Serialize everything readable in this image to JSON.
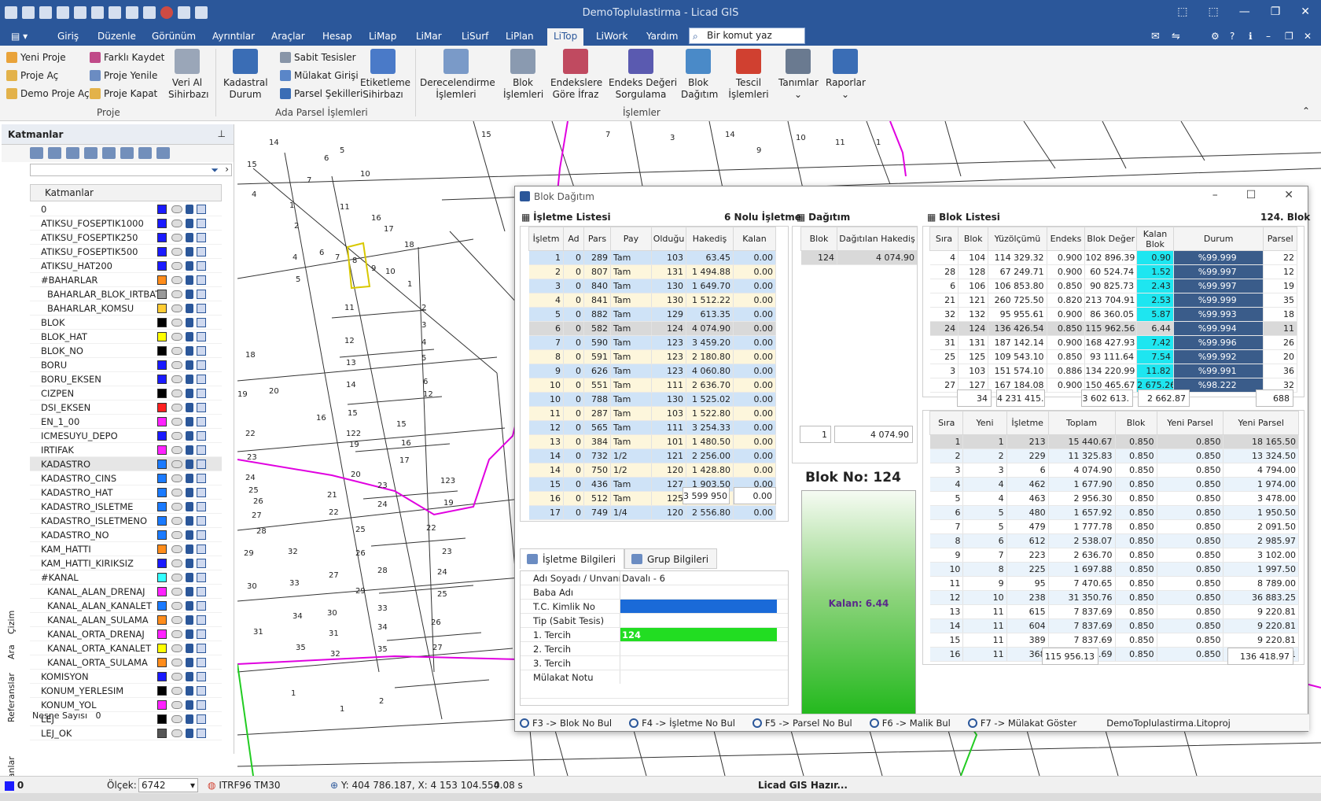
{
  "window": {
    "title": "DemoToplulastirma - Licad GIS",
    "controls": [
      "⬚",
      "⬚",
      "—",
      "❐",
      "✕"
    ]
  },
  "tabs": [
    "Giriş",
    "Düzenle",
    "Görünüm",
    "Ayrıntılar",
    "Araçlar",
    "Hesap",
    "LiMap",
    "LiMar",
    "LiSurf",
    "LiPlan",
    "LiTop",
    "LiWork",
    "Yardım"
  ],
  "active_tab": "LiTop",
  "command_search": {
    "placeholder": "Bir komut yaz"
  },
  "ribbon": {
    "proje": {
      "items": [
        "Yeni Proje",
        "Proje Aç",
        "Demo Proje Aç",
        "Farklı Kaydet",
        "Proje Yenile",
        "Proje Kapat"
      ],
      "big": "Veri Al\nSihirbazı",
      "group": "Proje"
    },
    "ada": {
      "kadastral": "Kadastral\nDurum",
      "items": [
        "Sabit Tesisler",
        "Mülakat Girişi",
        "Parsel Şekilleri"
      ],
      "etiket": "Etiketleme\nSihirbazı",
      "group": "Ada Parsel İşlemleri"
    },
    "big": [
      "Derecelendirme\nİşlemleri",
      "Blok\nİşlemleri",
      "Endekslere\nGöre İfraz",
      "Endeks Değeri\nSorgulama",
      "Blok\nDağıtım",
      "Tescil\nİşlemleri",
      "Tanımlar",
      "Raporlar"
    ],
    "islemler_group": "İşlemler"
  },
  "layers_panel": {
    "title": "Katmanlar",
    "column": "Katmanlar",
    "rows": [
      {
        "name": "0",
        "color": "#1a1aff"
      },
      {
        "name": "ATIKSU_FOSEPTIK1000",
        "color": "#1a1aff"
      },
      {
        "name": "ATIKSU_FOSEPTIK250",
        "color": "#1a1aff"
      },
      {
        "name": "ATIKSU_FOSEPTIK500",
        "color": "#1a1aff"
      },
      {
        "name": "ATIKSU_HAT200",
        "color": "#1a1aff"
      },
      {
        "name": "#BAHARLAR",
        "color": "#ff8c1a"
      },
      {
        "name": "BAHARLAR_BLOK_IRTBAT",
        "color": "#999999"
      },
      {
        "name": "BAHARLAR_KOMSU",
        "color": "#ffcc33"
      },
      {
        "name": "BLOK",
        "color": "#000000"
      },
      {
        "name": "BLOK_HAT",
        "color": "#ffff00"
      },
      {
        "name": "BLOK_NO",
        "color": "#000000"
      },
      {
        "name": "BORU",
        "color": "#1a1aff"
      },
      {
        "name": "BORU_EKSEN",
        "color": "#1a1aff"
      },
      {
        "name": "CIZPEN",
        "color": "#000000"
      },
      {
        "name": "DSI_EKSEN",
        "color": "#ff2020"
      },
      {
        "name": "EN_1_00",
        "color": "#ff22ff"
      },
      {
        "name": "ICMESUYU_DEPO",
        "color": "#1a1aff"
      },
      {
        "name": "IRTIFAK",
        "color": "#ff22ff"
      },
      {
        "name": "KADASTRO",
        "color": "#1a7aff"
      },
      {
        "name": "KADASTRO_CINS",
        "color": "#1a7aff"
      },
      {
        "name": "KADASTRO_HAT",
        "color": "#1a7aff"
      },
      {
        "name": "KADASTRO_ISLETME",
        "color": "#1a7aff"
      },
      {
        "name": "KADASTRO_ISLETMENO",
        "color": "#1a7aff"
      },
      {
        "name": "KADASTRO_NO",
        "color": "#1a7aff"
      },
      {
        "name": "KAM_HATTI",
        "color": "#ff8c1a"
      },
      {
        "name": "KAM_HATTI_KIRIKSIZ",
        "color": "#1a1aff"
      },
      {
        "name": "#KANAL",
        "color": "#33ffff"
      },
      {
        "name": "KANAL_ALAN_DRENAJ",
        "color": "#ff22ff"
      },
      {
        "name": "KANAL_ALAN_KANALET",
        "color": "#1a7aff"
      },
      {
        "name": "KANAL_ALAN_SULAMA",
        "color": "#ff8c1a"
      },
      {
        "name": "KANAL_ORTA_DRENAJ",
        "color": "#ff22ff"
      },
      {
        "name": "KANAL_ORTA_KANALET",
        "color": "#ffff00"
      },
      {
        "name": "KANAL_ORTA_SULAMA",
        "color": "#ff8c1a"
      },
      {
        "name": "KOMISYON",
        "color": "#1a1aff"
      },
      {
        "name": "KONUM_YERLESIM",
        "color": "#000000"
      },
      {
        "name": "KONUM_YOL",
        "color": "#ff22ff"
      },
      {
        "name": "LEJ",
        "color": "#000000"
      },
      {
        "name": "LEJ_OK",
        "color": "#555555"
      }
    ],
    "nesne_label": "Nesne Sayısı",
    "nesne_value": "0",
    "vtabs": [
      "Çizim",
      "Ara",
      "Referanslar",
      "Katmanlar"
    ]
  },
  "dialog": {
    "title": "Blok Dağıtım",
    "isletme_title": "İşletme Listesi",
    "isletme_badge": "6 Nolu İşletme",
    "isletme_cols": [
      "İşletm",
      "Ad",
      "Pars",
      "Pay",
      "Olduğu",
      "Hakediş",
      "Kalan"
    ],
    "isletme_rows": [
      [
        "1",
        "0",
        "289",
        "Tam",
        "103",
        "63.45",
        "0.00"
      ],
      [
        "2",
        "0",
        "807",
        "Tam",
        "131",
        "1 494.88",
        "0.00"
      ],
      [
        "3",
        "0",
        "840",
        "Tam",
        "130",
        "1 649.70",
        "0.00"
      ],
      [
        "4",
        "0",
        "841",
        "Tam",
        "130",
        "1 512.22",
        "0.00"
      ],
      [
        "5",
        "0",
        "882",
        "Tam",
        "129",
        "613.35",
        "0.00"
      ],
      [
        "6",
        "0",
        "582",
        "Tam",
        "124",
        "4 074.90",
        "0.00"
      ],
      [
        "7",
        "0",
        "590",
        "Tam",
        "123",
        "3 459.20",
        "0.00"
      ],
      [
        "8",
        "0",
        "591",
        "Tam",
        "123",
        "2 180.80",
        "0.00"
      ],
      [
        "9",
        "0",
        "626",
        "Tam",
        "123",
        "4 060.80",
        "0.00"
      ],
      [
        "10",
        "0",
        "551",
        "Tam",
        "111",
        "2 636.70",
        "0.00"
      ],
      [
        "10",
        "0",
        "788",
        "Tam",
        "130",
        "1 525.02",
        "0.00"
      ],
      [
        "11",
        "0",
        "287",
        "Tam",
        "103",
        "1 522.80",
        "0.00"
      ],
      [
        "12",
        "0",
        "565",
        "Tam",
        "111",
        "3 254.33",
        "0.00"
      ],
      [
        "13",
        "0",
        "384",
        "Tam",
        "101",
        "1 480.50",
        "0.00"
      ],
      [
        "14",
        "0",
        "732",
        "1/2",
        "121",
        "2 256.00",
        "0.00"
      ],
      [
        "14",
        "0",
        "750",
        "1/2",
        "120",
        "1 428.80",
        "0.00"
      ],
      [
        "15",
        "0",
        "436",
        "Tam",
        "127",
        "1 903.50",
        "0.00"
      ],
      [
        "16",
        "0",
        "512",
        "Tam",
        "125",
        "3 735.32",
        "0.00"
      ],
      [
        "17",
        "0",
        "749",
        "1/4",
        "120",
        "2 556.80",
        "0.00"
      ]
    ],
    "isletme_sum": [
      "3 599 950",
      "0.00"
    ],
    "dagitim_title": "Dağıtım",
    "dagitim_cols": [
      "Blok",
      "Dağıtılan Hakediş"
    ],
    "dagitim_rows": [
      [
        "124",
        "4 074.90"
      ]
    ],
    "dagitim_sum": [
      "1",
      "4 074.90"
    ],
    "blok_no": "Blok No: 124",
    "kalan": "Kalan: 6.44",
    "blok_title": "Blok Listesi",
    "blok_badge": "124. Blok",
    "blok_cols": [
      "Sıra",
      "Blok",
      "Yüzölçümü",
      "Endeks",
      "Blok Değer",
      "Kalan Blok",
      "Durum",
      "Parsel"
    ],
    "blok_rows": [
      [
        "4",
        "104",
        "114 329.32",
        "0.900",
        "102 896.39",
        "0.90",
        "%99.999",
        "22"
      ],
      [
        "28",
        "128",
        "67 249.71",
        "0.900",
        "60 524.74",
        "1.52",
        "%99.997",
        "12"
      ],
      [
        "6",
        "106",
        "106 853.80",
        "0.850",
        "90 825.73",
        "2.43",
        "%99.997",
        "19"
      ],
      [
        "21",
        "121",
        "260 725.50",
        "0.820",
        "213 704.91",
        "2.53",
        "%99.999",
        "35"
      ],
      [
        "32",
        "132",
        "95 955.61",
        "0.900",
        "86 360.05",
        "5.87",
        "%99.993",
        "18"
      ],
      [
        "24",
        "124",
        "136 426.54",
        "0.850",
        "115 962.56",
        "6.44",
        "%99.994",
        "11"
      ],
      [
        "31",
        "131",
        "187 142.14",
        "0.900",
        "168 427.93",
        "7.42",
        "%99.996",
        "26"
      ],
      [
        "25",
        "125",
        "109 543.10",
        "0.850",
        "93 111.64",
        "7.54",
        "%99.992",
        "20"
      ],
      [
        "3",
        "103",
        "151 574.10",
        "0.886",
        "134 220.99",
        "11.82",
        "%99.991",
        "36"
      ],
      [
        "27",
        "127",
        "167 184.08",
        "0.900",
        "150 465.67",
        "2 675.26",
        "%98.222",
        "32"
      ]
    ],
    "blok_sum": [
      "34",
      "4 231 415.",
      "3 602 613.",
      "2 662.87",
      "688"
    ],
    "parsel_cols": [
      "Sıra",
      "Yeni",
      "İşletme",
      "Toplam",
      "Blok",
      "Yeni Parsel",
      "Yeni Parsel"
    ],
    "parsel_rows": [
      [
        "1",
        "1",
        "213",
        "15 440.67",
        "0.850",
        "0.850",
        "18 165.50"
      ],
      [
        "2",
        "2",
        "229",
        "11 325.83",
        "0.850",
        "0.850",
        "13 324.50"
      ],
      [
        "3",
        "3",
        "6",
        "4 074.90",
        "0.850",
        "0.850",
        "4 794.00"
      ],
      [
        "4",
        "4",
        "462",
        "1 677.90",
        "0.850",
        "0.850",
        "1 974.00"
      ],
      [
        "5",
        "4",
        "463",
        "2 956.30",
        "0.850",
        "0.850",
        "3 478.00"
      ],
      [
        "6",
        "5",
        "480",
        "1 657.92",
        "0.850",
        "0.850",
        "1 950.50"
      ],
      [
        "7",
        "5",
        "479",
        "1 777.78",
        "0.850",
        "0.850",
        "2 091.50"
      ],
      [
        "8",
        "6",
        "612",
        "2 538.07",
        "0.850",
        "0.850",
        "2 985.97"
      ],
      [
        "9",
        "7",
        "223",
        "2 636.70",
        "0.850",
        "0.850",
        "3 102.00"
      ],
      [
        "10",
        "8",
        "225",
        "1 697.88",
        "0.850",
        "0.850",
        "1 997.50"
      ],
      [
        "11",
        "9",
        "95",
        "7 470.65",
        "0.850",
        "0.850",
        "8 789.00"
      ],
      [
        "12",
        "10",
        "238",
        "31 350.76",
        "0.850",
        "0.850",
        "36 883.25"
      ],
      [
        "13",
        "11",
        "615",
        "7 837.69",
        "0.850",
        "0.850",
        "9 220.81"
      ],
      [
        "14",
        "11",
        "604",
        "7 837.69",
        "0.850",
        "0.850",
        "9 220.81"
      ],
      [
        "15",
        "11",
        "389",
        "7 837.69",
        "0.850",
        "0.850",
        "9 220.81"
      ],
      [
        "16",
        "11",
        "368",
        "7 837.69",
        "0.850",
        "0.850",
        "9 220.81"
      ]
    ],
    "parsel_sum": [
      "115 956.13",
      "136 418.97"
    ],
    "form_tabs": [
      "İşletme Bilgileri",
      "Grup Bilgileri"
    ],
    "form_rows": [
      {
        "k": "Adı Soyadı / Unvanı",
        "v": "Davalı - 6"
      },
      {
        "k": "Baba Adı",
        "v": ""
      },
      {
        "k": "T.C. Kimlik No",
        "v": ""
      },
      {
        "k": "Tip (Sabit Tesis)",
        "v": ""
      },
      {
        "k": "1. Tercih",
        "v": "124"
      },
      {
        "k": "2. Tercih",
        "v": ""
      },
      {
        "k": "3. Tercih",
        "v": ""
      },
      {
        "k": "Mülakat Notu",
        "v": ""
      }
    ],
    "fkeys": [
      "F3 -> Blok No Bul",
      "F4 -> İşletme No Bul",
      "F5 -> Parsel No Bul",
      "F6 -> Malik Bul",
      "F7 -> Mülakat Göster",
      "DemoToplulastirma.Litoproj"
    ]
  },
  "status": {
    "layer": "0",
    "olcek_label": "Ölçek:",
    "olcek": "6742",
    "crs": "ITRF96 TM30",
    "coords": "Y: 404 786.187, X: 4 153 104.554",
    "time": "0.08 s",
    "ready": "Licad GIS Hazır..."
  },
  "colors": {
    "accent": "#2b579a",
    "cyan": "#1ee6f0",
    "navy": "#3a5c8a",
    "yellow_row": "#fdf6dc",
    "blue_row": "#cfe3f7"
  }
}
